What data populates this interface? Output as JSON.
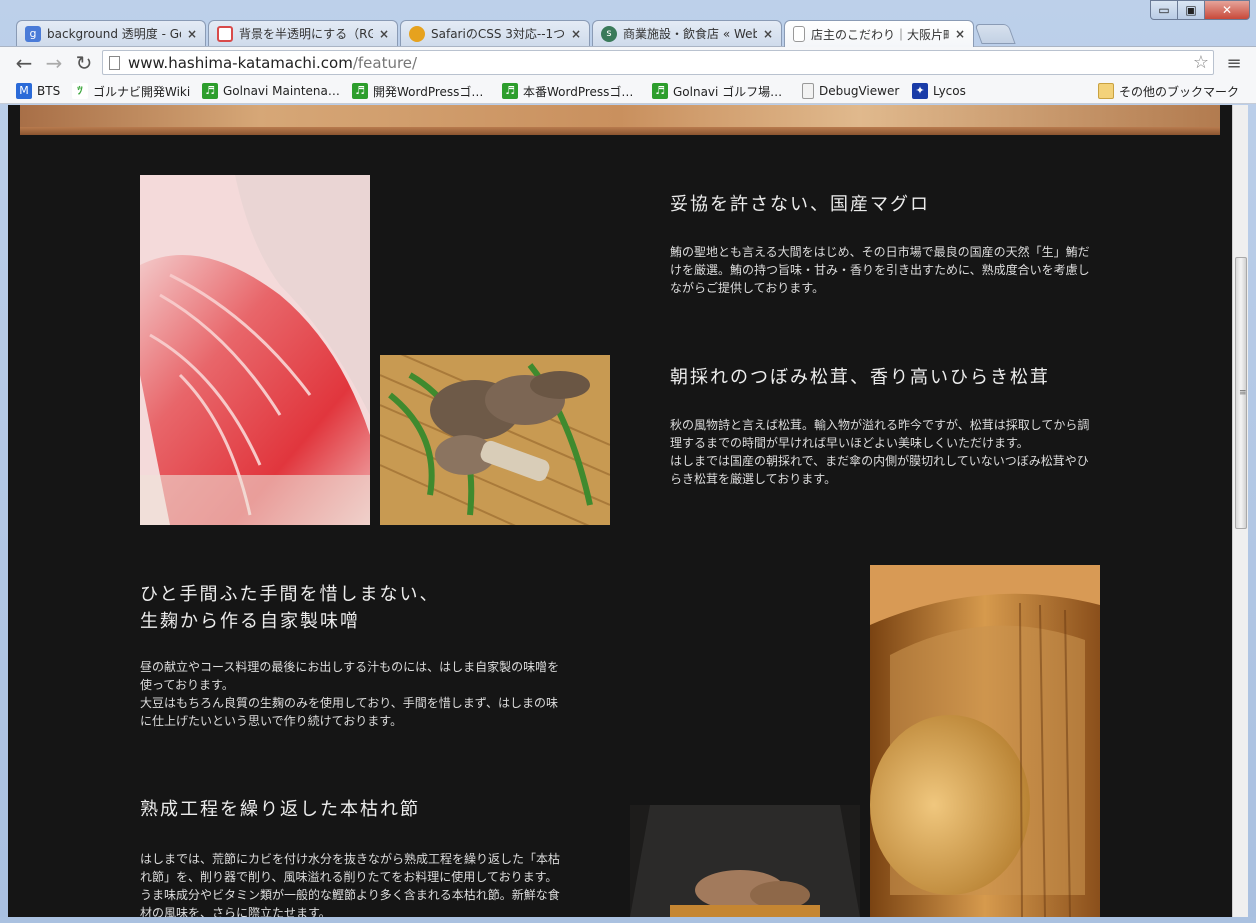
{
  "browser": {
    "tabs": [
      {
        "title": "background 透明度 - Go",
        "favicon": "google-icon",
        "color": "#4a7bd8"
      },
      {
        "title": "背景を半透明にする（RG",
        "favicon": "pages-icon",
        "color": "#d84a4a"
      },
      {
        "title": "SafariのCSS 3対応--1つ",
        "favicon": "safari-icon",
        "color": "#e6a21e"
      },
      {
        "title": "商業施設・飲食店 « Web",
        "favicon": "s-icon",
        "color": "#3a7a5a"
      },
      {
        "title": "店主のこだわり｜大阪片町",
        "favicon": "page-icon",
        "color": "#ffffff"
      }
    ],
    "active_tab": 4,
    "close_glyph": "×",
    "url_host": "www.hashima-katamachi.com",
    "url_path": "/feature/",
    "bookmarks": [
      {
        "label": "BTS",
        "icon": "m-icon",
        "color": "#2a6ad8",
        "glyph": "M"
      },
      {
        "label": "ゴルナビ開発Wiki",
        "icon": "wiki-icon",
        "color": "#3aa53a",
        "glyph": "ﾂ"
      },
      {
        "label": "Golnavi Maintena…",
        "icon": "redmine-icon",
        "color": "#2d9e2d",
        "glyph": "♬"
      },
      {
        "label": "開発WordPressゴ…",
        "icon": "redmine-icon",
        "color": "#2d9e2d",
        "glyph": "♬"
      },
      {
        "label": "本番WordPressゴ…",
        "icon": "redmine-icon",
        "color": "#2d9e2d",
        "glyph": "♬"
      },
      {
        "label": "Golnavi ゴルフ場…",
        "icon": "redmine-icon",
        "color": "#2d9e2d",
        "glyph": "♬"
      },
      {
        "label": "DebugViewer",
        "icon": "page-icon",
        "color": "#f2f2f2",
        "glyph": ""
      },
      {
        "label": "Lycos",
        "icon": "lycos-icon",
        "color": "#1a3ca8",
        "glyph": "✦"
      }
    ],
    "other_bookmarks": "その他のブックマーク"
  },
  "page": {
    "sections": [
      {
        "heading": "妥協を許さない、国産マグロ",
        "body": [
          "鮪の聖地とも言える大間をはじめ、その日市場で最良の国産の天然「生」鮪だけを厳選。鮪の持つ旨味・甘み・香りを引き出すために、熟成度合いを考慮しながらご提供しております。"
        ]
      },
      {
        "heading": "朝採れのつぼみ松茸、香り高いひらき松茸",
        "body": [
          "秋の風物詩と言えば松茸。輸入物が溢れる昨今ですが、松茸は採取してから調理するまでの時間が早ければ早いほどよい美味しくいただけます。",
          "はしまでは国産の朝採れで、まだ傘の内側が膜切れしていないつぼみ松茸やひらき松茸を厳選しております。"
        ]
      },
      {
        "heading_lines": [
          "ひと手間ふた手間を惜しまない、",
          "生麹から作る自家製味噌"
        ],
        "body": [
          "昼の献立やコース料理の最後にお出しする汁ものには、はしま自家製の味噌を使っております。",
          "大豆はもちろん良質の生麹のみを使用しており、手間を惜しまず、はしまの味に仕上げたいという思いで作り続けております。"
        ]
      },
      {
        "heading": "熟成工程を繰り返した本枯れ節",
        "body": [
          "はしまでは、荒節にカビを付け水分を抜きながら熟成工程を繰り返した「本枯れ節」を、削り器で削り、風味溢れる削りたてをお料理に使用しております。うま味成分やビタミン類が一般的な鰹節より多く含まれる本枯れ節。新鮮な食材の風味を、さらに際立たせます。"
        ]
      }
    ]
  }
}
